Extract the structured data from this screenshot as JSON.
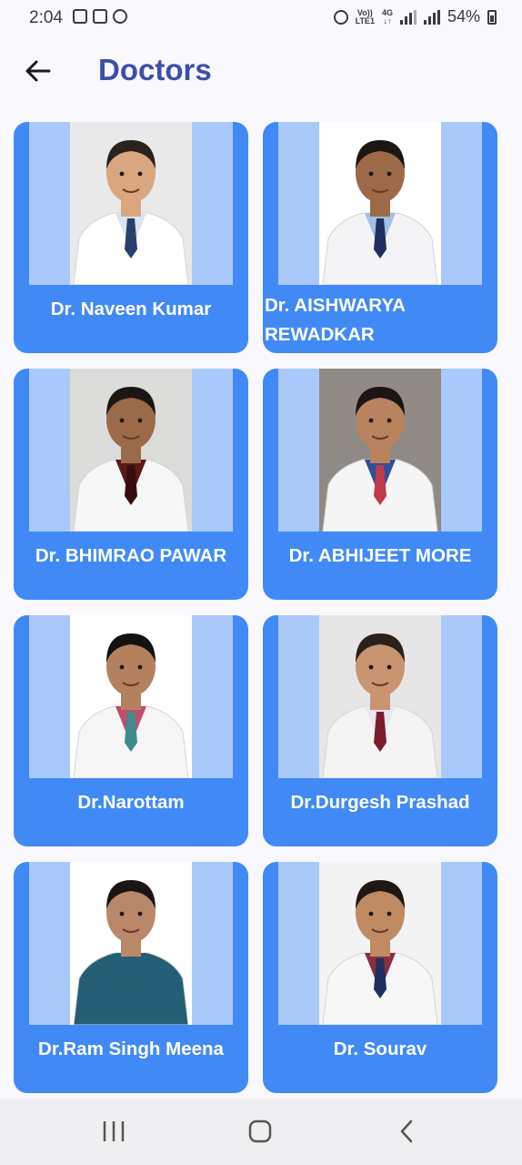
{
  "status": {
    "time": "2:04",
    "net_top": "Vo))",
    "net_bottom": "LTE1",
    "gen_top": "4G",
    "gen_bottom": "↓↑",
    "battery": "54%"
  },
  "header": {
    "title": "Doctors",
    "back_icon": "arrow-left-icon"
  },
  "doctors": [
    {
      "name": "Dr. Naveen Kumar",
      "bg": "#e9e9ea",
      "coat": "#ffffff",
      "shirt": "#d9e4f2",
      "tie": "#2a3f6b",
      "skin": "#d9a77f",
      "hair": "#2a221c"
    },
    {
      "name": "Dr. AISHWARYA REWADKAR",
      "bg": "#ffffff",
      "coat": "#f4f4f6",
      "shirt": "#9fc0e6",
      "tie": "#1f2f5f",
      "skin": "#9c6a48",
      "hair": "#1c1712"
    },
    {
      "name": "Dr. BHIMRAO PAWAR",
      "bg": "#dcdcda",
      "coat": "#f7f7f7",
      "shirt": "#5a1a1a",
      "tie": "#3a0c0f",
      "skin": "#9b6a48",
      "hair": "#1b1613"
    },
    {
      "name": "Dr. ABHIJEET MORE",
      "bg": "#8f8a85",
      "coat": "#f5f5f5",
      "shirt": "#2e4f9a",
      "tie": "#c03a4a",
      "skin": "#b8835e",
      "hair": "#1a1512"
    },
    {
      "name": "Dr.Narottam",
      "bg": "#ffffff",
      "coat": "#f6f6f6",
      "shirt": "#c24c6b",
      "tie": "#3d8c8a",
      "skin": "#b4815f",
      "hair": "#141210"
    },
    {
      "name": "Dr.Durgesh Prashad",
      "bg": "#e6e6e6",
      "coat": "#f4f4f4",
      "shirt": "#e9e6f0",
      "tie": "#7a1c2c",
      "skin": "#c99472",
      "hair": "#2a211b"
    },
    {
      "name": "Dr.Ram Singh Meena",
      "bg": "#ffffff",
      "coat": "#245f75",
      "shirt": "#245f75",
      "tie": "#245f75",
      "skin": "#b9876a",
      "hair": "#1a1412"
    },
    {
      "name": "Dr. Sourav",
      "bg": "#f3f3f3",
      "coat": "#f7f7f7",
      "shirt": "#8a2d45",
      "tie": "#1f2f5f",
      "skin": "#c08a63",
      "hair": "#1d1814"
    }
  ],
  "navbar": {
    "recent_icon": "recent-apps-icon",
    "home_icon": "home-icon",
    "back_icon": "back-nav-icon"
  }
}
